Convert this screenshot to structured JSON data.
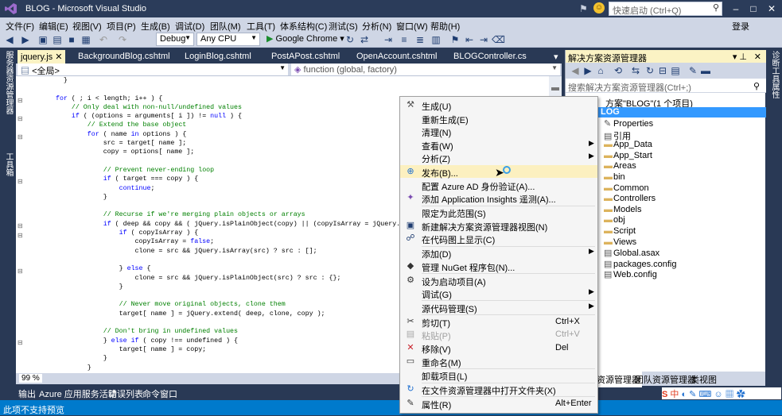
{
  "window": {
    "title": "BLOG - Microsoft Visual Studio",
    "quick_launch_placeholder": "快速启动 (Ctrl+Q)",
    "login": "登录"
  },
  "menu": [
    "文件(F)",
    "编辑(E)",
    "视图(V)",
    "项目(P)",
    "生成(B)",
    "调试(D)",
    "团队(M)",
    "工具(T)",
    "体系结构(C)",
    "测试(S)",
    "分析(N)",
    "窗口(W)",
    "帮助(H)"
  ],
  "toolbar": {
    "config": "Debug",
    "platform": "Any CPU",
    "run": "Google Chrome"
  },
  "left_tabs": [
    "服务器资源管理器",
    "工具箱"
  ],
  "right_tabs": [
    "诊断工具",
    "属性"
  ],
  "doc_tabs": [
    "jquery.js",
    "BackgroundBlog.cshtml",
    "LoginBlog.cshtml",
    "PostAPost.cshtml",
    "OpenAccount.cshtml",
    "BLOGController.cs"
  ],
  "nav": {
    "scope": "<全局>",
    "member": "function (global, factory)"
  },
  "zoom": "99 %",
  "bottom_tabs": [
    "输出",
    "Azure 应用服务活动",
    "错误列表",
    "命令窗口"
  ],
  "status": "此项不支持预览",
  "solution": {
    "title": "解决方案资源管理器",
    "search_placeholder": "搜索解决方案资源管理器(Ctrl+;)",
    "root": "方案\"BLOG\"(1 个项目)",
    "project": "LOG",
    "items": [
      "Properties",
      "引用",
      "App_Data",
      "App_Start",
      "Areas",
      "bin",
      "Common",
      "Controllers",
      "Models",
      "obj",
      "Script",
      "Views",
      "Global.asax",
      "packages.config",
      "Web.config"
    ],
    "tabs": [
      "资源管理器",
      "团队资源管理器",
      "类视图"
    ]
  },
  "context_menu": [
    {
      "icon": "build-icon",
      "label": "生成(U)"
    },
    {
      "icon": "",
      "label": "重新生成(E)"
    },
    {
      "icon": "",
      "label": "清理(N)"
    },
    {
      "icon": "",
      "label": "查看(W)",
      "submenu": true
    },
    {
      "icon": "",
      "label": "分析(Z)",
      "submenu": true,
      "sep_after": true
    },
    {
      "icon": "globe-icon",
      "label": "发布(B)...",
      "highlight": true
    },
    {
      "icon": "",
      "label": "配置 Azure AD 身份验证(A)..."
    },
    {
      "icon": "insights-icon",
      "label": "添加 Application Insights 遥测(A)...",
      "sep_after": true
    },
    {
      "icon": "",
      "label": "限定为此范围(S)"
    },
    {
      "icon": "new-view-icon",
      "label": "新建解决方案资源管理器视图(N)"
    },
    {
      "icon": "code-map-icon",
      "label": "在代码图上显示(C)",
      "sep_after": true
    },
    {
      "icon": "",
      "label": "添加(D)",
      "submenu": true
    },
    {
      "icon": "nuget-icon",
      "label": "管理 NuGet 程序包(N)...",
      "sep_after": true
    },
    {
      "icon": "gear-icon",
      "label": "设为启动项目(A)"
    },
    {
      "icon": "",
      "label": "调试(G)",
      "submenu": true,
      "sep_after": true
    },
    {
      "icon": "",
      "label": "源代码管理(S)",
      "submenu": true,
      "sep_after": true
    },
    {
      "icon": "cut-icon",
      "label": "剪切(T)",
      "shortcut": "Ctrl+X"
    },
    {
      "icon": "paste-icon",
      "label": "粘贴(P)",
      "shortcut": "Ctrl+V",
      "disabled": true
    },
    {
      "icon": "remove-icon",
      "label": "移除(V)",
      "shortcut": "Del"
    },
    {
      "icon": "rename-icon",
      "label": "重命名(M)",
      "sep_after": true
    },
    {
      "icon": "",
      "label": "卸载项目(L)",
      "sep_after": true
    },
    {
      "icon": "open-folder-icon",
      "label": "在文件资源管理器中打开文件夹(X)",
      "sep_after": true
    },
    {
      "icon": "wrench-icon",
      "label": "属性(R)",
      "shortcut": "Alt+Enter"
    }
  ],
  "watermark": "https://blog.csdn.net/qq_37290023",
  "ime": "中"
}
